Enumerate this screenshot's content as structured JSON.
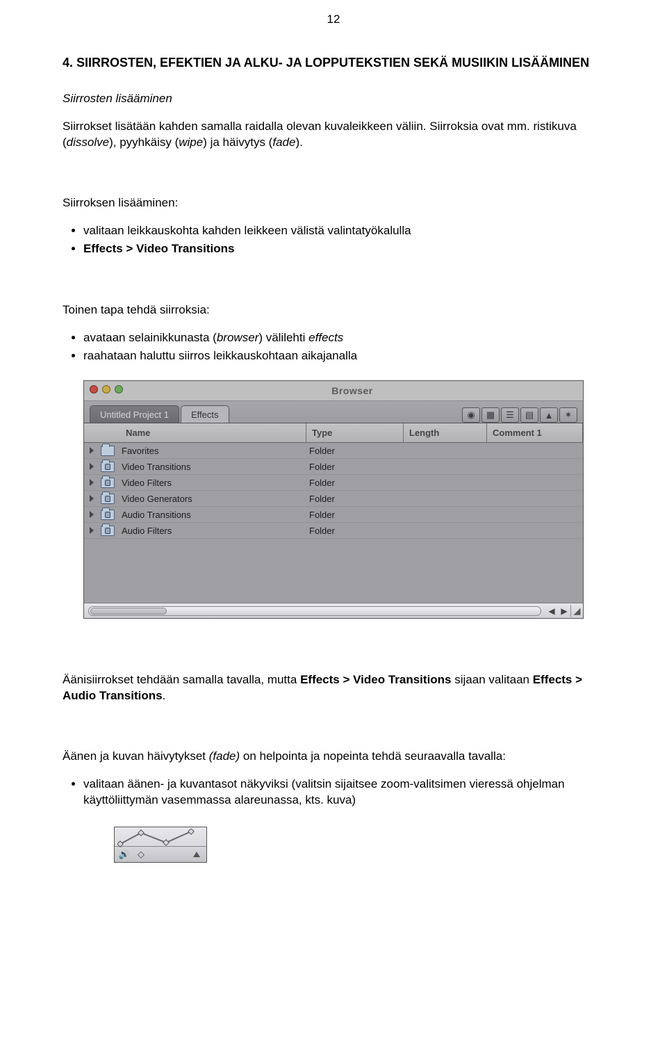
{
  "page_number": "12",
  "heading": "4. SIIRROSTEN, EFEKTIEN JA ALKU- JA LOPPUTEKSTIEN SEKÄ MUSIIKIN LISÄÄMINEN",
  "sub1_title": "Siirrosten lisääminen",
  "sub1_p1a": "Siirrokset lisätään kahden samalla raidalla olevan kuvaleikkeen väliin. Siirroksia ovat mm. ristikuva (",
  "sub1_p1b": "dissolve",
  "sub1_p1c": "), pyyhkäisy (",
  "sub1_p1d": "wipe",
  "sub1_p1e": ") ja häivytys (",
  "sub1_p1f": "fade",
  "sub1_p1g": ").",
  "sub2_title": "Siirroksen lisääminen:",
  "sub2_items": [
    {
      "text": "valitaan leikkauskohta kahden leikkeen välistä valintatyökalulla"
    },
    {
      "pre": "",
      "bold": "Effects > Video Transitions"
    }
  ],
  "sub3_title": "Toinen tapa tehdä siirroksia:",
  "sub3_items": [
    {
      "pre": "avataan selainikkunasta (",
      "it": "browser",
      "mid": ") välilehti ",
      "it2": "effects"
    },
    {
      "text": "raahataan haluttu siirros leikkauskohtaan aikajanalla"
    }
  ],
  "browser": {
    "title": "Browser",
    "tabs": [
      "Untitled Project 1",
      "Effects"
    ],
    "columns": [
      "Name",
      "Type",
      "Length",
      "Comment 1"
    ],
    "rows": [
      {
        "name": "Favorites",
        "type": "Folder",
        "locked": false
      },
      {
        "name": "Video Transitions",
        "type": "Folder",
        "locked": true
      },
      {
        "name": "Video Filters",
        "type": "Folder",
        "locked": true
      },
      {
        "name": "Video Generators",
        "type": "Folder",
        "locked": true
      },
      {
        "name": "Audio Transitions",
        "type": "Folder",
        "locked": true
      },
      {
        "name": "Audio Filters",
        "type": "Folder",
        "locked": true
      }
    ]
  },
  "after_shot_p1a": "Äänisiirrokset tehdään samalla tavalla, mutta ",
  "after_shot_p1b": "Effects > Video Transitions",
  "after_shot_p1c": " sijaan valitaan ",
  "after_shot_p1d": "Effects > Audio Transitions",
  "after_shot_p1e": ".",
  "fade_p1a": "Äänen ja kuvan häivytykset ",
  "fade_p1b": "(fade)",
  "fade_p1c": " on helpointa ja nopeinta tehdä seuraavalla tavalla:",
  "fade_items": [
    "valitaan äänen- ja kuvantasot näkyviksi (valitsin sijaitsee zoom-valitsimen vieressä ohjelman käyttöliittymän vasemmassa alareunassa, kts. kuva)"
  ]
}
